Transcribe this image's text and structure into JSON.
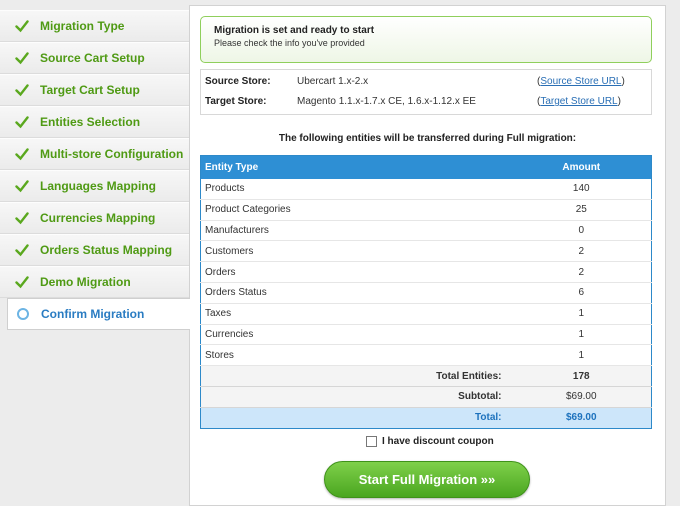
{
  "sidebar": {
    "steps": [
      {
        "label": "Migration Type"
      },
      {
        "label": "Source Cart Setup"
      },
      {
        "label": "Target Cart Setup"
      },
      {
        "label": "Entities Selection"
      },
      {
        "label": "Multi-store Configuration"
      },
      {
        "label": "Languages Mapping"
      },
      {
        "label": "Currencies Mapping"
      },
      {
        "label": "Orders Status Mapping"
      },
      {
        "label": "Demo Migration"
      }
    ],
    "active": {
      "label": "Confirm Migration"
    }
  },
  "notice": {
    "title": "Migration is set and ready to start",
    "subtitle": "Please check the info you've provided"
  },
  "stores": {
    "source": {
      "label": "Source Store:",
      "value": "Ubercart 1.x-2.x",
      "link_open": "(",
      "link": "Source Store URL",
      "link_close": ")"
    },
    "target": {
      "label": "Target Store:",
      "value": "Magento 1.1.x-1.7.x CE, 1.6.x-1.12.x EE",
      "link_open": "(",
      "link": "Target Store URL",
      "link_close": ")"
    }
  },
  "caption": "The following entities will be transferred during Full migration:",
  "table": {
    "headers": {
      "entity": "Entity Type",
      "amount": "Amount"
    },
    "rows": [
      {
        "entity": "Products",
        "amount": "140"
      },
      {
        "entity": "Product Categories",
        "amount": "25"
      },
      {
        "entity": "Manufacturers",
        "amount": "0"
      },
      {
        "entity": "Customers",
        "amount": "2"
      },
      {
        "entity": "Orders",
        "amount": "2"
      },
      {
        "entity": "Orders Status",
        "amount": "6"
      },
      {
        "entity": "Taxes",
        "amount": "1"
      },
      {
        "entity": "Currencies",
        "amount": "1"
      },
      {
        "entity": "Stores",
        "amount": "1"
      }
    ],
    "total_entities": {
      "label": "Total Entities:",
      "value": "178"
    },
    "subtotal": {
      "label": "Subtotal:",
      "value": "$69.00"
    },
    "total": {
      "label": "Total:",
      "value": "$69.00"
    }
  },
  "coupon": {
    "label": "I have discount coupon"
  },
  "start_button": {
    "label": "Start Full Migration »»"
  },
  "colors": {
    "accent_green": "#4f9a14",
    "accent_blue": "#2e8fd4",
    "active_blue": "#2a7cc2"
  }
}
